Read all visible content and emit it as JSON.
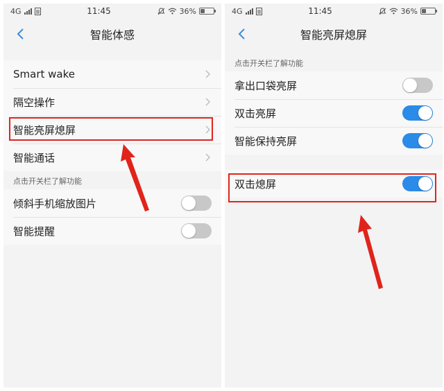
{
  "colors": {
    "toggle_on": "#2a8be8",
    "toggle_off": "#c8c8c8",
    "highlight": "#e0241b",
    "back_icon": "#3a8be0"
  },
  "left": {
    "status": {
      "network": "4G",
      "time": "11:45",
      "battery": "36%",
      "battery_level": 0.36
    },
    "title": "智能体感",
    "items": [
      {
        "label": "Smart wake"
      },
      {
        "label": "隔空操作"
      },
      {
        "label": "智能亮屏熄屏"
      },
      {
        "label": "智能通话"
      }
    ],
    "section_header": "点击开关栏了解功能",
    "toggles": [
      {
        "label": "倾斜手机缩放图片",
        "on": false
      },
      {
        "label": "智能提醒",
        "on": false
      }
    ]
  },
  "right": {
    "status": {
      "network": "4G",
      "time": "11:45",
      "battery": "36%",
      "battery_level": 0.36
    },
    "title": "智能亮屏熄屏",
    "section_header": "点击开关栏了解功能",
    "toggles": [
      {
        "label": "拿出口袋亮屏",
        "on": false
      },
      {
        "label": "双击亮屏",
        "on": true
      },
      {
        "label": "智能保持亮屏",
        "on": true
      }
    ],
    "toggles2": [
      {
        "label": "双击熄屏",
        "on": true
      }
    ]
  }
}
